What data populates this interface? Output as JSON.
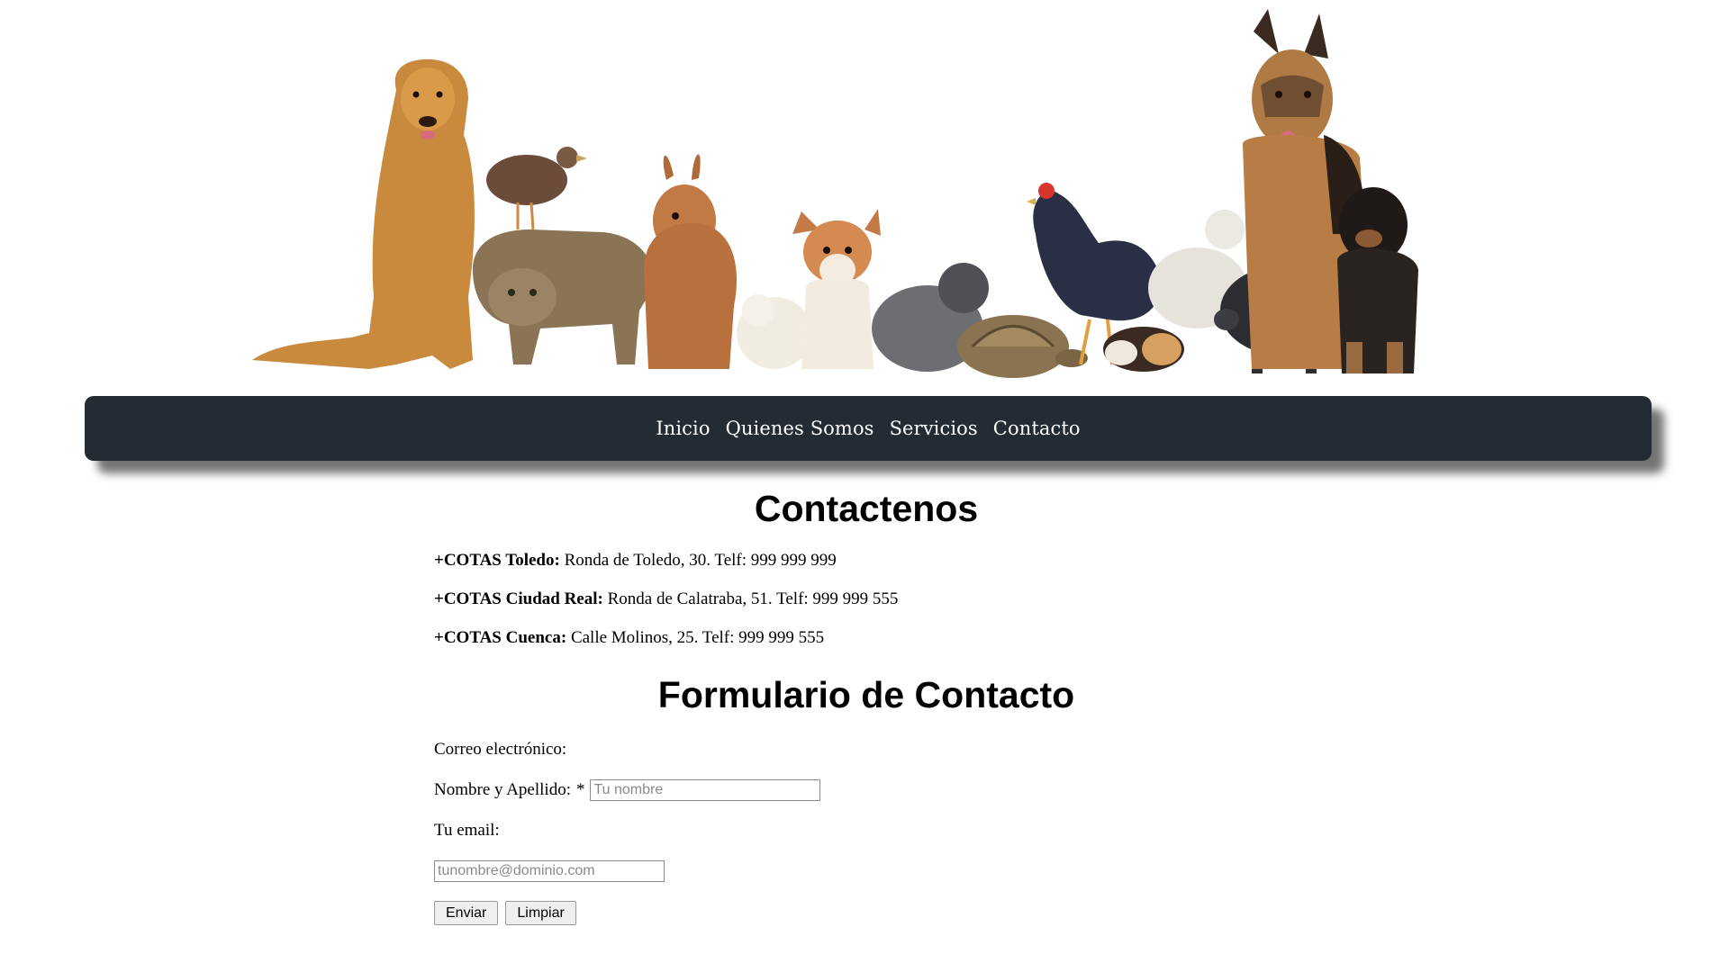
{
  "banner": {
    "alt": "Grupo de mascotas: perros, gato, conejo, gallinas, tortuga, cobaya y cerdo"
  },
  "nav": {
    "items": [
      {
        "label": "Inicio"
      },
      {
        "label": "Quienes Somos"
      },
      {
        "label": "Servicios"
      },
      {
        "label": "Contacto"
      }
    ]
  },
  "contact": {
    "title": "Contactenos",
    "branches": [
      {
        "name": "+COTAS Toledo:",
        "detail": " Ronda de Toledo, 30. Telf: 999 999 999"
      },
      {
        "name": "+COTAS Ciudad Real:",
        "detail": " Ronda de Calatraba, 51. Telf: 999 999 555"
      },
      {
        "name": "+COTAS Cuenca:",
        "detail": " Calle Molinos, 25. Telf: 999 999 555"
      }
    ]
  },
  "form": {
    "title": "Formulario de Contacto",
    "email_section_label": "Correo electrónico:",
    "name_label": "Nombre y Apellido:",
    "required_mark": "*",
    "name_placeholder": "Tu nombre",
    "name_value": "",
    "email_label": "Tu email:",
    "email_placeholder": "tunombre@dominio.com",
    "email_value": "",
    "submit_label": "Enviar",
    "reset_label": "Limpiar"
  },
  "colors": {
    "nav_background": "#232b35",
    "nav_text": "#ffffff",
    "page_background": "#ffffff"
  }
}
